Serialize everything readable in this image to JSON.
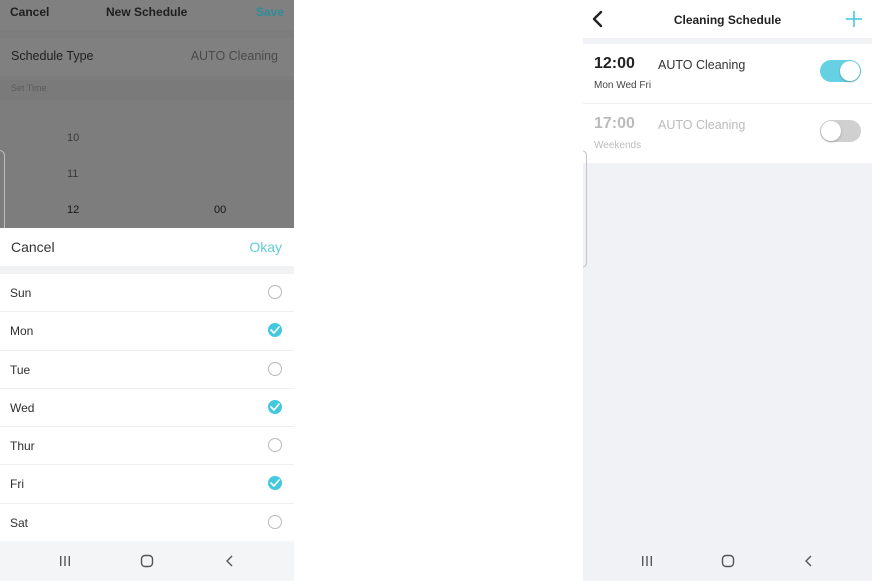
{
  "left_screen": {
    "header": {
      "cancel": "Cancel",
      "title": "New Schedule",
      "save": "Save"
    },
    "schedule_type": {
      "label": "Schedule Type",
      "value": "AUTO Cleaning"
    },
    "set_time": {
      "label": "Set Time"
    },
    "time_picker": {
      "hours": [
        "10",
        "11",
        "12"
      ],
      "selected_hour": "12",
      "selected_minute": "00"
    },
    "repeat_sheet": {
      "cancel": "Cancel",
      "okay": "Okay",
      "days": [
        {
          "label": "Sun",
          "selected": false
        },
        {
          "label": "Mon",
          "selected": true
        },
        {
          "label": "Tue",
          "selected": false
        },
        {
          "label": "Wed",
          "selected": true
        },
        {
          "label": "Thur",
          "selected": false
        },
        {
          "label": "Fri",
          "selected": true
        },
        {
          "label": "Sat",
          "selected": false
        }
      ]
    }
  },
  "right_screen": {
    "header": {
      "title": "Cleaning Schedule"
    },
    "schedules": [
      {
        "time": "12:00",
        "type": "AUTO Cleaning",
        "days": "Mon Wed Fri",
        "enabled": true
      },
      {
        "time": "17:00",
        "type": "AUTO Cleaning",
        "days": "Weekends",
        "enabled": false
      }
    ]
  },
  "icons": {
    "nav_recent": "recent-apps-icon",
    "nav_home": "home-icon",
    "nav_back": "back-icon",
    "header_back": "chevron-left-icon",
    "header_add": "plus-icon",
    "check": "check-icon"
  },
  "colors": {
    "accent": "#43c9dd",
    "toggle_on": "#65d1e3",
    "toggle_off": "#d0d0d0",
    "okay_text": "#62cbdc",
    "save_text": "#2f8c99"
  }
}
